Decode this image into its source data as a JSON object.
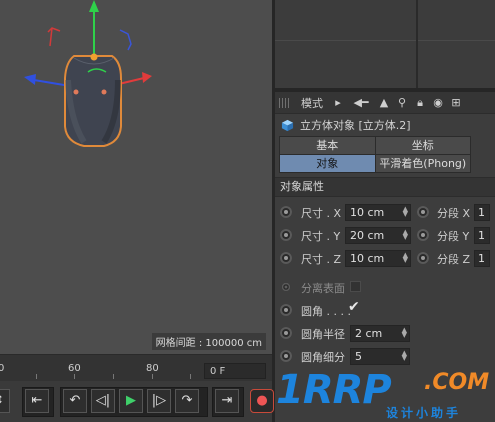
{
  "viewport": {
    "grid_spacing": "网格间距 : 100000 cm"
  },
  "attribute_manager": {
    "toolbar": {
      "mode_label": "模式",
      "icons": [
        "play-arrow-icon",
        "back-arrow-icon",
        "up-arrow-icon",
        "search-icon",
        "lock-icon",
        "target-icon",
        "new-panel-icon"
      ]
    },
    "object_title": "立方体对象 [立方体.2]",
    "tabs": [
      {
        "label": "基本",
        "active": false
      },
      {
        "label": "坐标",
        "active": false
      },
      {
        "label": "对象",
        "active": true
      },
      {
        "label": "平滑着色(Phong)",
        "active": false
      }
    ],
    "section_title": "对象属性",
    "size": {
      "x_label": "尺寸 . X",
      "x_value": "10 cm",
      "y_label": "尺寸 . Y",
      "y_value": "20 cm",
      "z_label": "尺寸 . Z",
      "z_value": "10 cm"
    },
    "segments": {
      "x_label": "分段 X",
      "x_value": "1",
      "y_label": "分段 Y",
      "y_value": "1",
      "z_label": "分段 Z",
      "z_value": "1"
    },
    "separate_surfaces": {
      "label": "分离表面",
      "checked": false
    },
    "fillet": {
      "label": "圆角 . . . .",
      "checked": true,
      "check_glyph": "✔"
    },
    "fillet_radius": {
      "label": "圆角半径",
      "value": "2 cm"
    },
    "fillet_subdivision": {
      "label": "圆角细分",
      "value": "5"
    }
  },
  "timeline": {
    "ticks": [
      "0",
      "60",
      "80"
    ],
    "frame": "0 F"
  },
  "transport": {
    "buttons": [
      "⇤",
      "↶",
      "◁|",
      "▶",
      "|▷",
      "↷",
      "⇥"
    ]
  },
  "watermark": {
    "main": "1RRP",
    "com": ".COM",
    "sub": "设计小助手"
  },
  "colors": {
    "accent_tab": "#6f8bb0",
    "play": "#3fd06a",
    "watermark_blue": "#1d84dd",
    "watermark_orange": "#f08a28",
    "axis_y": "#2fd14a",
    "axis_x": "#e23b3b",
    "axis_z": "#3050e0",
    "selection_outline": "#e08a3a"
  }
}
